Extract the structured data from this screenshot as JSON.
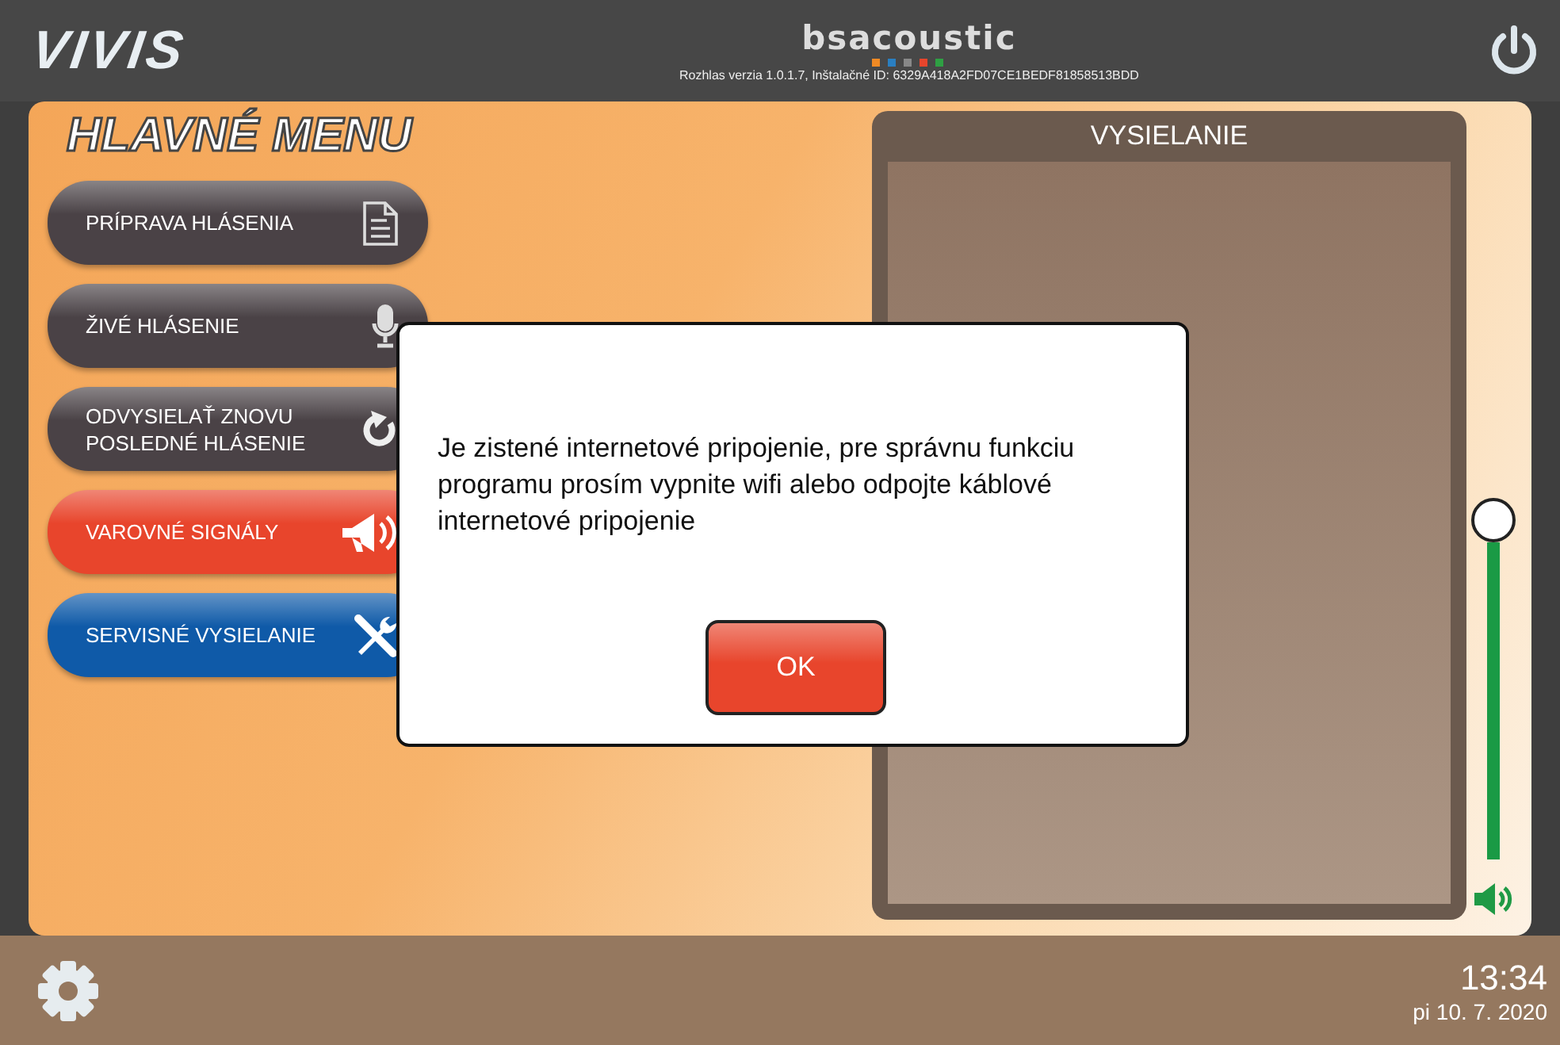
{
  "header": {
    "logo": "VIVIS",
    "brand": "bsacoustic",
    "version": "Rozhlas verzia 1.0.1.7, Inštalačné ID: 6329A418A2FD07CE1BEDF81858513BDD"
  },
  "menu": {
    "title": "HLAVNÉ MENU",
    "items": [
      {
        "label": "PRÍPRAVA HLÁSENIA",
        "color": "#4a4246"
      },
      {
        "label": "ŽIVÉ HLÁSENIE",
        "color": "#4a4246"
      },
      {
        "label": "ODVYSIELAŤ ZNOVU POSLEDNÉ HLÁSENIE",
        "color": "#4a4246"
      },
      {
        "label": "VAROVNÉ SIGNÁLY",
        "color": "#e8452c"
      },
      {
        "label": "SERVISNÉ VYSIELANIE",
        "color": "#0f5aa8"
      }
    ]
  },
  "broadcast": {
    "title": "VYSIELANIE"
  },
  "volume": {
    "level": 1
  },
  "dialog": {
    "message": "Je zistené internetové pripojenie, pre správnu funkciu programu prosím vypnite wifi alebo odpojte káblové internetové pripojenie",
    "button": "OK"
  },
  "status": {
    "time": "13:34",
    "date": "pi 10. 7. 2020"
  }
}
